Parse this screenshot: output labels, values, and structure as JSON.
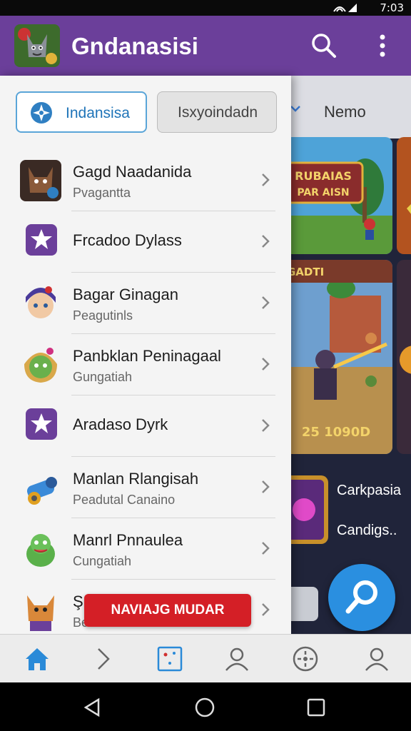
{
  "status": {
    "time": "7:03"
  },
  "app": {
    "title": "Gndanasisi",
    "logo_icon": "cat-game-logo-icon",
    "accent": "#6b3f9a"
  },
  "background": {
    "tab_label": "Nemo",
    "card1_title": "RUBAIAS PAR AISN",
    "card2_title": "GADTI",
    "card2_score": "25 1090D",
    "side_labels": [
      "Carkpasia",
      "Candigs.."
    ]
  },
  "drawer": {
    "tabs": [
      {
        "label": "Indansisa",
        "icon": "compass-icon",
        "selected": true
      },
      {
        "label": "Isxyoindadn",
        "selected": false
      }
    ],
    "items": [
      {
        "title": "Gagd Naadanida",
        "subtitle": "Pvagantta",
        "icon": "wolf-avatar-icon"
      },
      {
        "title": "Frcadoo Dylass",
        "subtitle": "",
        "icon": "star-badge-icon"
      },
      {
        "title": "Bagar Ginagan",
        "subtitle": "Peagutinls",
        "icon": "girl-avatar-icon"
      },
      {
        "title": "Panbklan Peninagaal",
        "subtitle": "Gungatiah",
        "icon": "elf-avatar-icon"
      },
      {
        "title": "Aradaso Dyrk",
        "subtitle": "",
        "icon": "star-badge-icon"
      },
      {
        "title": "Manlan Rlangisah",
        "subtitle": "Peadutal Canaino",
        "icon": "cannon-icon"
      },
      {
        "title": "Manrl Pnnaulea",
        "subtitle": "Cungatiah",
        "icon": "dragon-avatar-icon"
      },
      {
        "title": "Ş",
        "subtitle": "Be",
        "icon": "fox-avatar-icon"
      }
    ],
    "toast_button": "NAVIAJG MUDAR"
  },
  "bottom_nav": [
    "home-icon",
    "chevron-right-icon",
    "grid-card-icon",
    "profile-icon",
    "settings-dial-icon",
    "account-icon"
  ]
}
